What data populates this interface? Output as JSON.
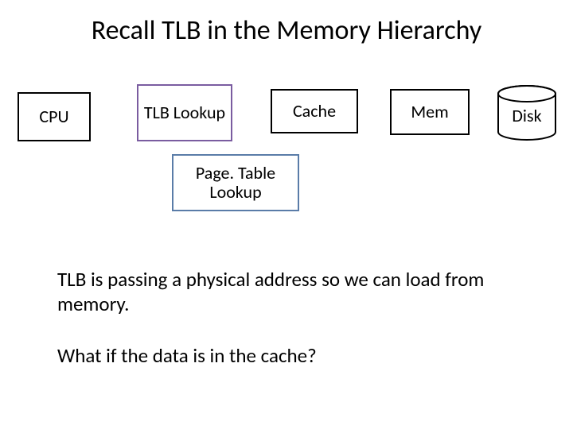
{
  "title": "Recall TLB in the Memory Hierarchy",
  "boxes": {
    "cpu": "CPU",
    "tlb": "TLB Lookup",
    "cache": "Cache",
    "mem": "Mem",
    "disk": "Disk",
    "pagetable": "Page. Table Lookup"
  },
  "paragraphs": {
    "p1": "TLB is passing a physical address so we can load from memory.",
    "p2": "What if the data is in the cache?"
  }
}
